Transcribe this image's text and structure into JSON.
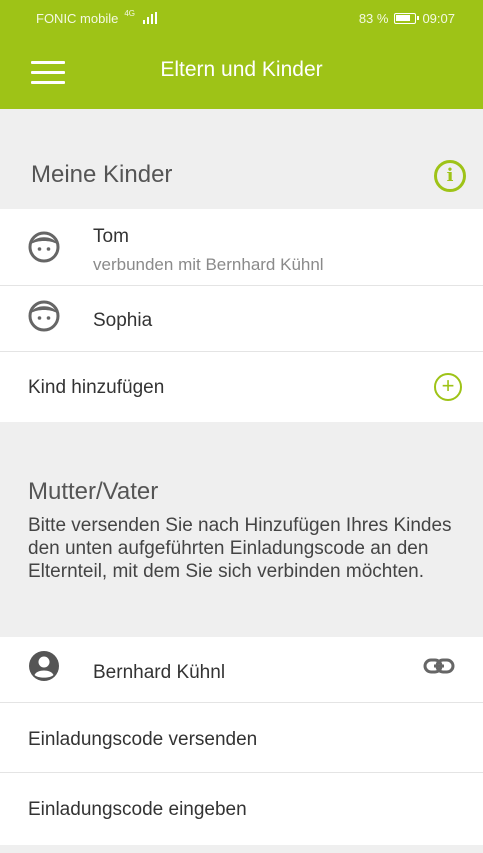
{
  "status": {
    "carrier": "FONIC mobile",
    "network": "4G",
    "battery": "83 %",
    "time": "09:07"
  },
  "appbar": {
    "title": "Eltern und Kinder"
  },
  "kids": {
    "heading": "Meine Kinder",
    "items": [
      {
        "name": "Tom",
        "sub": "verbunden mit Bernhard Kühnl"
      },
      {
        "name": "Sophia"
      }
    ],
    "add_label": "Kind hinzufügen"
  },
  "parent": {
    "heading": "Mutter/Vater",
    "description": "Bitte versenden Sie nach Hinzufügen Ihres Kindes den unten aufgeführten Einladungscode an den Elternteil, mit dem Sie sich verbinden möchten.",
    "name": "Bernhard Kühnl",
    "send_code_label": "Einladungscode versenden",
    "enter_code_label": "Einladungscode eingeben"
  },
  "colors": {
    "accent": "#9ec317",
    "background": "#efefef"
  }
}
